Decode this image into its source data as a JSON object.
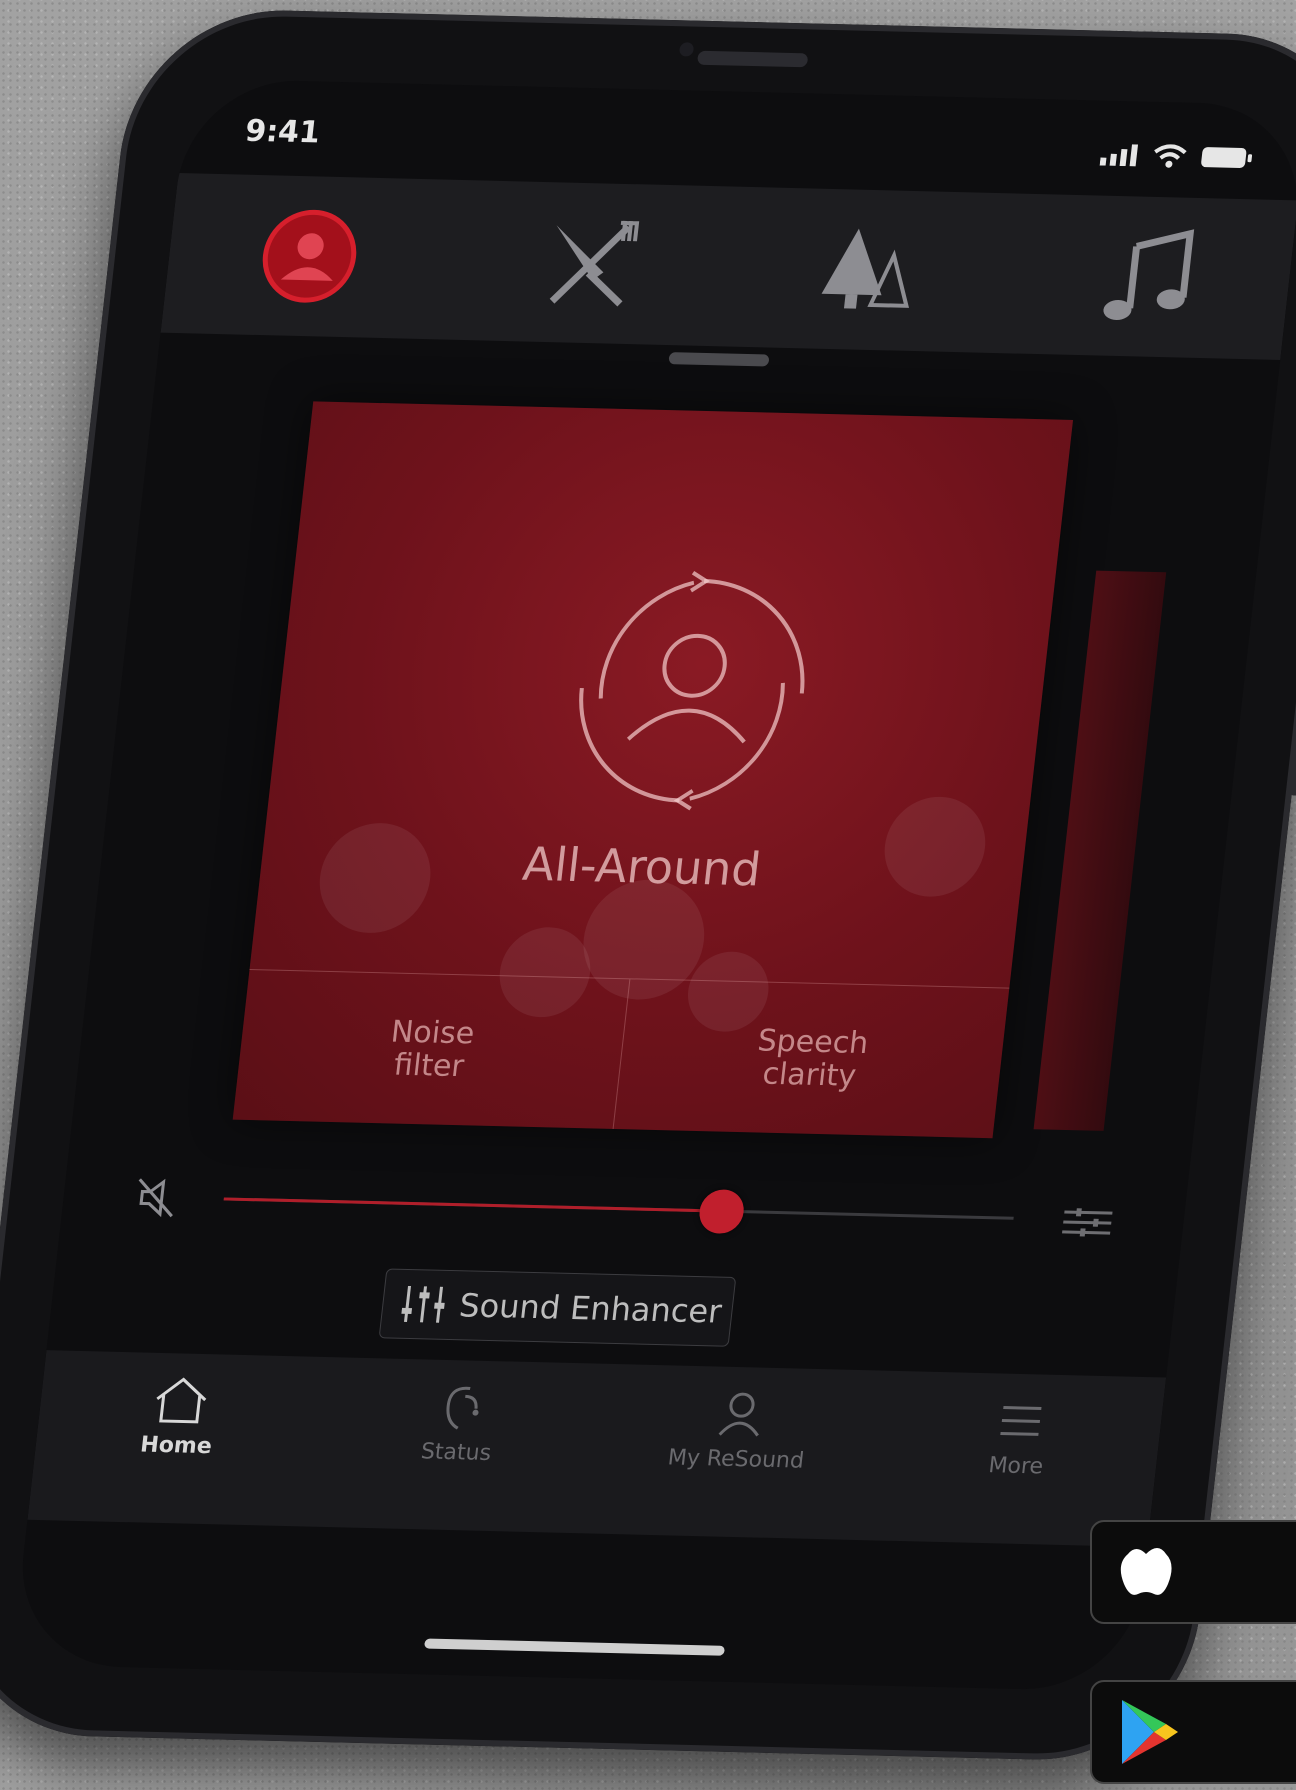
{
  "status_bar": {
    "time": "9:41"
  },
  "mode_bar": {
    "items": [
      {
        "icon": "all-around-icon",
        "active": true
      },
      {
        "icon": "restaurant-icon",
        "active": false
      },
      {
        "icon": "outdoor-icon",
        "active": false
      },
      {
        "icon": "music-icon",
        "active": false
      }
    ]
  },
  "program_card": {
    "title": "All-Around",
    "options": [
      "Noise\nfilter",
      "Speech\nclarity"
    ]
  },
  "volume": {
    "level": 0.63
  },
  "sound_enhancer": {
    "label": "Sound Enhancer"
  },
  "tab_bar": {
    "tabs": [
      {
        "label": "Home",
        "active": true
      },
      {
        "label": "Status",
        "active": false
      },
      {
        "label": "My ReSound",
        "active": false
      },
      {
        "label": "More",
        "active": false
      }
    ]
  },
  "colors": {
    "accent": "#c11f2d",
    "card": "#6e121b"
  }
}
